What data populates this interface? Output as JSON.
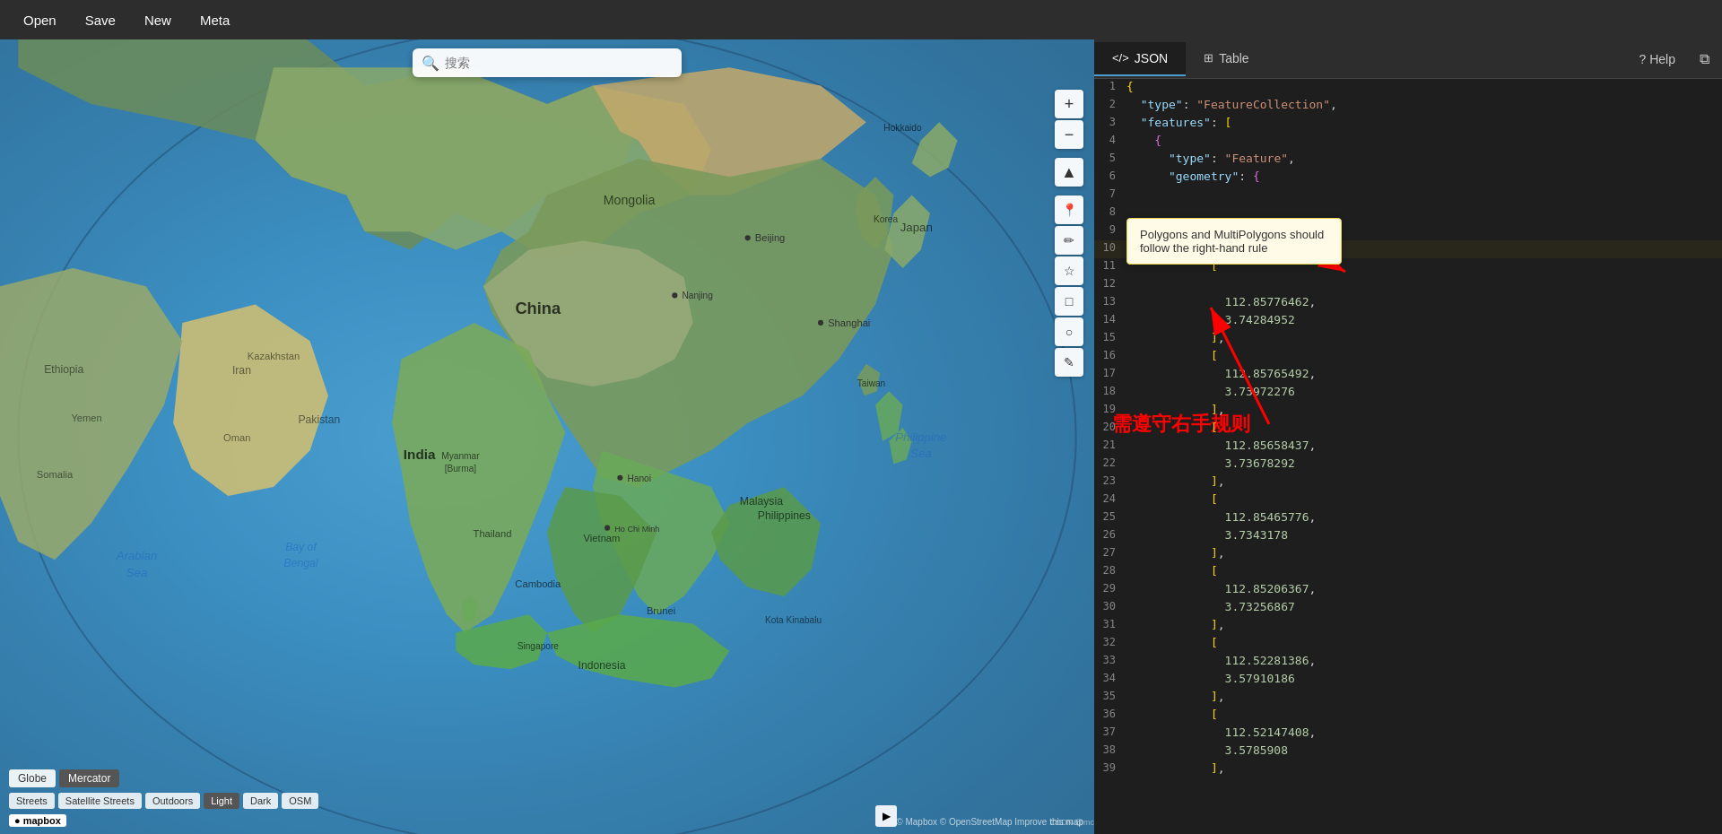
{
  "menubar": {
    "items": [
      "Open",
      "Save",
      "New",
      "Meta"
    ]
  },
  "search": {
    "placeholder": "搜索"
  },
  "map": {
    "projection_buttons": [
      {
        "label": "Globe",
        "active": false
      },
      {
        "label": "Mercator",
        "active": true
      }
    ],
    "style_buttons": [
      {
        "label": "Streets",
        "active": false
      },
      {
        "label": "Satellite Streets",
        "active": false
      },
      {
        "label": "Outdoors",
        "active": false
      },
      {
        "label": "Light",
        "active": true
      },
      {
        "label": "Dark",
        "active": false
      },
      {
        "label": "OSM",
        "active": false
      }
    ],
    "attribution": "© Mapbox © OpenStreetMap Improve this map",
    "logo": "mapbox"
  },
  "right_panel": {
    "tabs": [
      {
        "label": "JSON",
        "icon": "</>",
        "active": true
      },
      {
        "label": "Table",
        "icon": "⊞",
        "active": false
      },
      {
        "label": "Help",
        "icon": "?",
        "active": false
      }
    ]
  },
  "tooltip": {
    "text": "Polygons and MultiPolygons should follow the right-hand rule"
  },
  "annotation": {
    "chinese_text": "需遵守右手规则"
  },
  "json_lines": [
    {
      "num": 1,
      "content": "{",
      "type": "bracket"
    },
    {
      "num": 2,
      "content": "  \"type\": \"FeatureCollection\",",
      "key": "type",
      "value": "FeatureCollection"
    },
    {
      "num": 3,
      "content": "  \"features\": [",
      "key": "features"
    },
    {
      "num": 4,
      "content": "    {",
      "type": "bracket"
    },
    {
      "num": 5,
      "content": "      \"type\": \"Feature\",",
      "key": "type",
      "value": "Feature"
    },
    {
      "num": 6,
      "content": "      \"geometry\": {",
      "key": "geometry"
    },
    {
      "num": 7,
      "content": "",
      "type": "empty"
    },
    {
      "num": 8,
      "content": "",
      "type": "empty"
    },
    {
      "num": 9,
      "content": "",
      "type": "empty"
    },
    {
      "num": 10,
      "content": "          [",
      "type": "bracket"
    },
    {
      "num": 11,
      "content": "            [",
      "type": "bracket"
    },
    {
      "num": 12,
      "content": "",
      "type": "empty"
    },
    {
      "num": 13,
      "content": "              112.85776462,",
      "type": "number"
    },
    {
      "num": 14,
      "content": "              3.74284952",
      "type": "number"
    },
    {
      "num": 15,
      "content": "            ],",
      "type": "bracket"
    },
    {
      "num": 16,
      "content": "            [",
      "type": "bracket"
    },
    {
      "num": 17,
      "content": "              112.85765492,",
      "type": "number"
    },
    {
      "num": 18,
      "content": "              3.73972276",
      "type": "number"
    },
    {
      "num": 19,
      "content": "            ],",
      "type": "bracket"
    },
    {
      "num": 20,
      "content": "            [",
      "type": "bracket"
    },
    {
      "num": 21,
      "content": "              112.85658437,",
      "type": "number"
    },
    {
      "num": 22,
      "content": "              3.73678292",
      "type": "number"
    },
    {
      "num": 23,
      "content": "            ],",
      "type": "bracket"
    },
    {
      "num": 24,
      "content": "            [",
      "type": "bracket"
    },
    {
      "num": 25,
      "content": "              112.85465776,",
      "type": "number"
    },
    {
      "num": 26,
      "content": "              3.7343178",
      "type": "number"
    },
    {
      "num": 27,
      "content": "            ],",
      "type": "bracket"
    },
    {
      "num": 28,
      "content": "            [",
      "type": "bracket"
    },
    {
      "num": 29,
      "content": "              112.85206367,",
      "type": "number"
    },
    {
      "num": 30,
      "content": "              3.73256867",
      "type": "number"
    },
    {
      "num": 31,
      "content": "            ],",
      "type": "bracket"
    },
    {
      "num": 32,
      "content": "            [",
      "type": "bracket"
    },
    {
      "num": 33,
      "content": "              112.52281386,",
      "type": "number"
    },
    {
      "num": 34,
      "content": "              3.57910186",
      "type": "number"
    },
    {
      "num": 35,
      "content": "            ],",
      "type": "bracket"
    },
    {
      "num": 36,
      "content": "            [",
      "type": "bracket"
    },
    {
      "num": 37,
      "content": "              112.52147408,",
      "type": "number"
    },
    {
      "num": 38,
      "content": "              3.5785908",
      "type": "number"
    },
    {
      "num": 39,
      "content": "            ],",
      "type": "bracket"
    }
  ],
  "controls": {
    "zoom_in": "+",
    "zoom_out": "−",
    "up": "▲",
    "pin_icon": "📍",
    "line_icon": "✏",
    "star_icon": "☆",
    "rect_icon": "□",
    "circle_icon": "○",
    "edit_icon": "✎",
    "expand_icon": "▶"
  },
  "csdn": "CSDN @mc"
}
